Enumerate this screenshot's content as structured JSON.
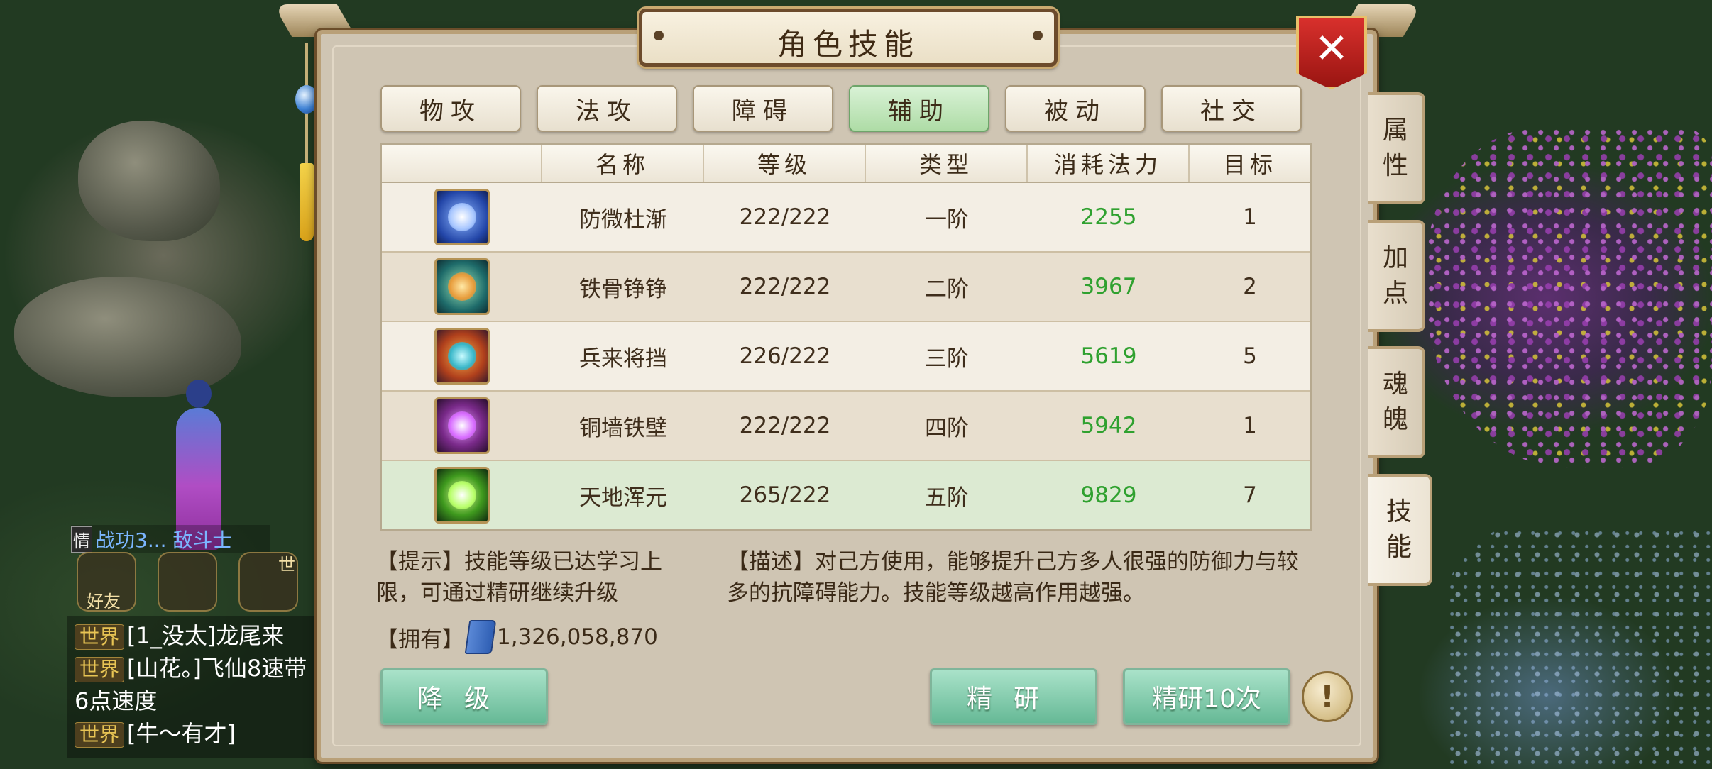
{
  "window": {
    "title": "角色技能"
  },
  "category_tabs": [
    {
      "label": "物攻",
      "active": false
    },
    {
      "label": "法攻",
      "active": false
    },
    {
      "label": "障碍",
      "active": false
    },
    {
      "label": "辅助",
      "active": true
    },
    {
      "label": "被动",
      "active": false
    },
    {
      "label": "社交",
      "active": false
    }
  ],
  "table": {
    "headers": [
      "",
      "名称",
      "等级",
      "类型",
      "消耗法力",
      "目标"
    ],
    "rows": [
      {
        "name": "防微杜渐",
        "level": "222/222",
        "type": "一阶",
        "mp": "2255",
        "target": "1",
        "icon": "blue-hand-icon"
      },
      {
        "name": "铁骨铮铮",
        "level": "222/222",
        "type": "二阶",
        "mp": "3967",
        "target": "2",
        "icon": "green-fist-icon"
      },
      {
        "name": "兵来将挡",
        "level": "226/222",
        "type": "三阶",
        "mp": "5619",
        "target": "5",
        "icon": "flame-shield-icon"
      },
      {
        "name": "铜墙铁壁",
        "level": "222/222",
        "type": "四阶",
        "mp": "5942",
        "target": "1",
        "icon": "purple-orb-icon"
      },
      {
        "name": "天地浑元",
        "level": "265/222",
        "type": "五阶",
        "mp": "9829",
        "target": "7",
        "icon": "green-burst-icon"
      }
    ],
    "selected_index": 4
  },
  "hint": "【提示】技能等级已达学习上限，可通过精研继续升级",
  "description": "【描述】对己方使用，能够提升己方多人很强的防御力与较多的抗障碍能力。技能等级越高作用越强。",
  "own": {
    "label": "【拥有】",
    "value": "1,326,058,870",
    "icon": "skill-book-icon"
  },
  "buttons": {
    "downgrade": "降级",
    "refine": "精研",
    "refine10": "精研10次"
  },
  "side_tabs": [
    {
      "label": "属性",
      "active": false
    },
    {
      "label": "加点",
      "active": false
    },
    {
      "label": "魂魄",
      "active": false
    },
    {
      "label": "技能",
      "active": true
    }
  ],
  "hud": {
    "team_tag": "情",
    "team_text": "战功3... 敌斗士",
    "friends_label": "好友",
    "mic_tag": "世",
    "chat": [
      {
        "tag": "世界",
        "text": "[1_没太]龙尾来"
      },
      {
        "tag": "世界",
        "text": "[山花。]飞仙8速带"
      },
      {
        "tag": "",
        "text": "6点速度"
      },
      {
        "tag": "世界",
        "text": "[牛～有才]"
      }
    ]
  },
  "colors": {
    "accent_green": "#2fa12f",
    "panel_bg": "#cfc5b3",
    "close_red": "#c0201c"
  }
}
